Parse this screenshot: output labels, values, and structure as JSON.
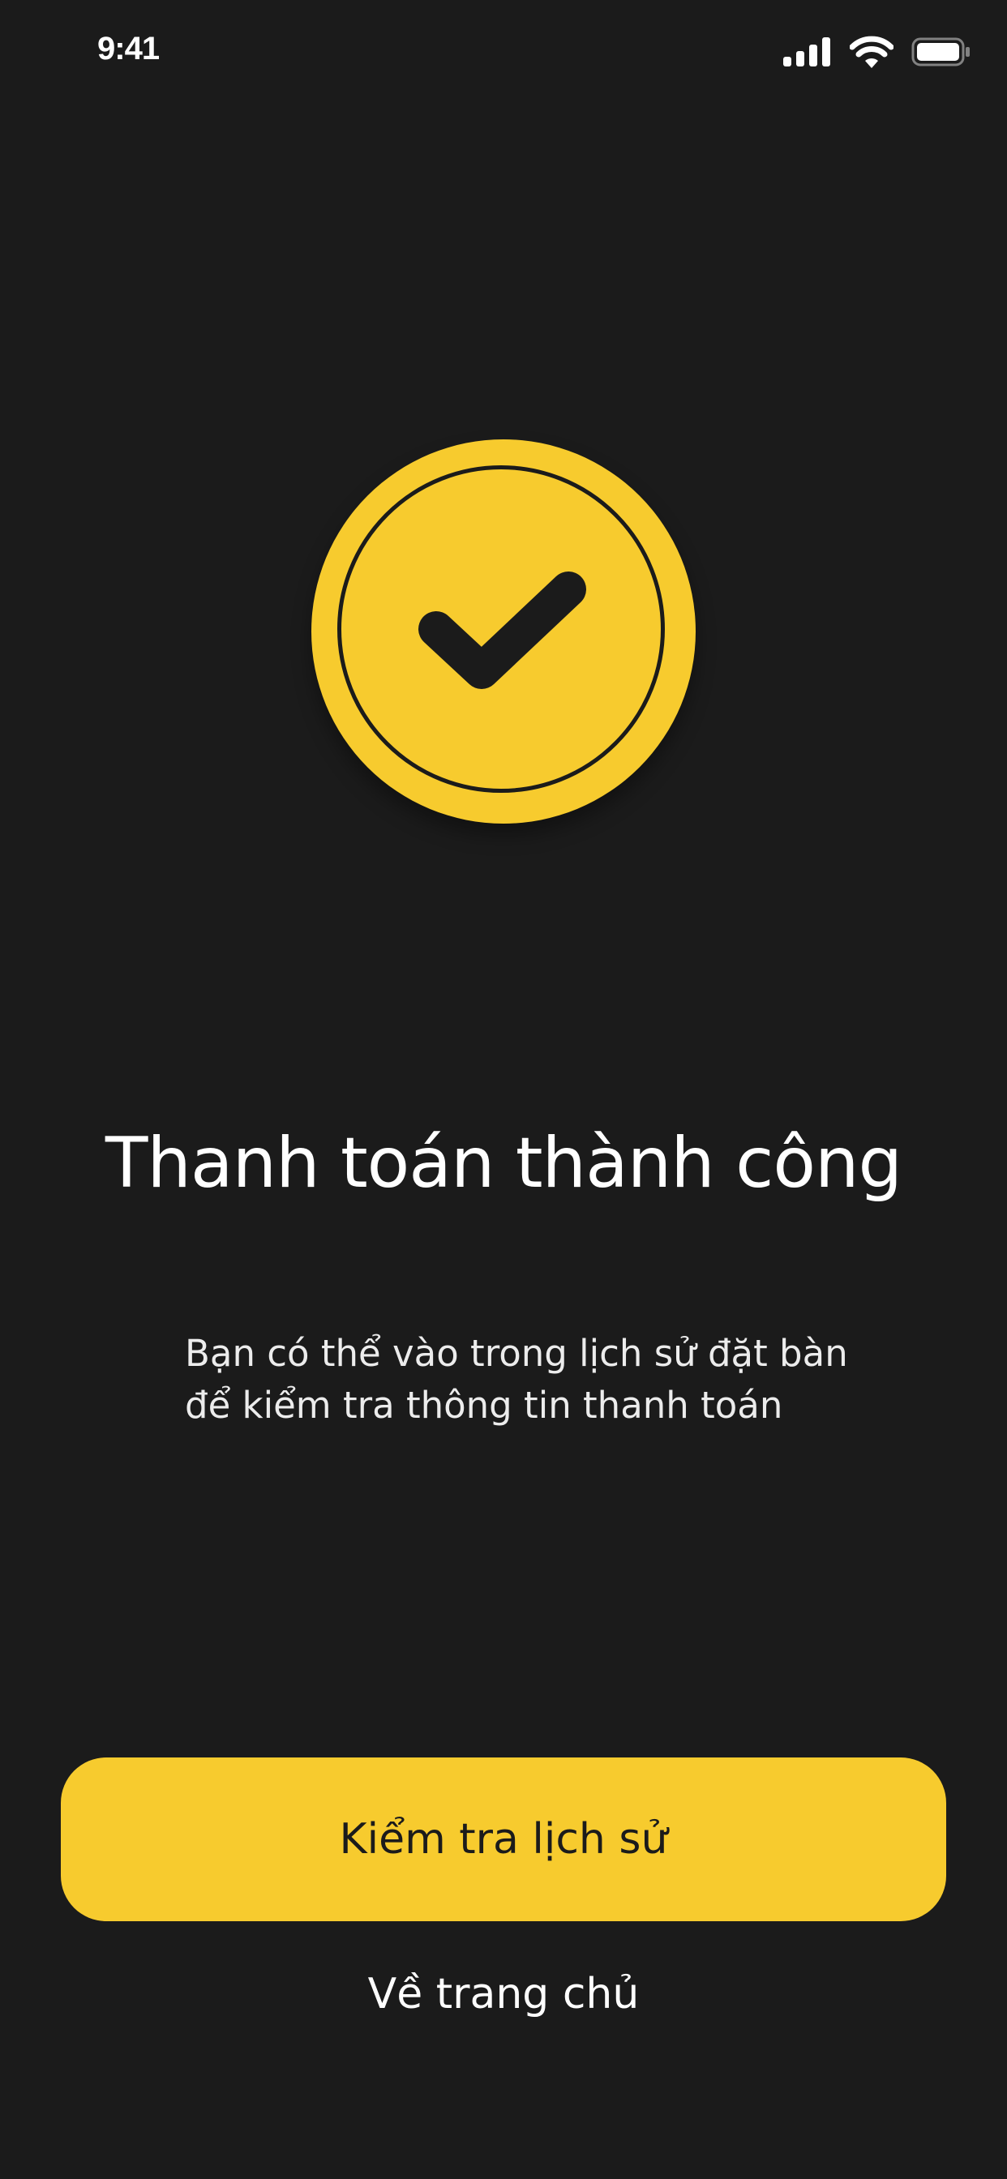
{
  "status_bar": {
    "time": "9:41",
    "icons": [
      "cellular-signal-icon",
      "wifi-icon",
      "battery-icon"
    ]
  },
  "success_icon": "checkmark-circle-icon",
  "colors": {
    "background": "#1b1b1b",
    "accent": "#f7cb2e",
    "text": "#ffffff"
  },
  "content": {
    "title": "Thanh toán thành công",
    "message_line_1": "Bạn có thể vào trong lịch sử đặt bàn",
    "message_line_2": "để kiểm tra thông tin thanh toán"
  },
  "actions": {
    "primary_label": "Kiểm tra lịch sử",
    "secondary_label": "Về trang chủ"
  }
}
